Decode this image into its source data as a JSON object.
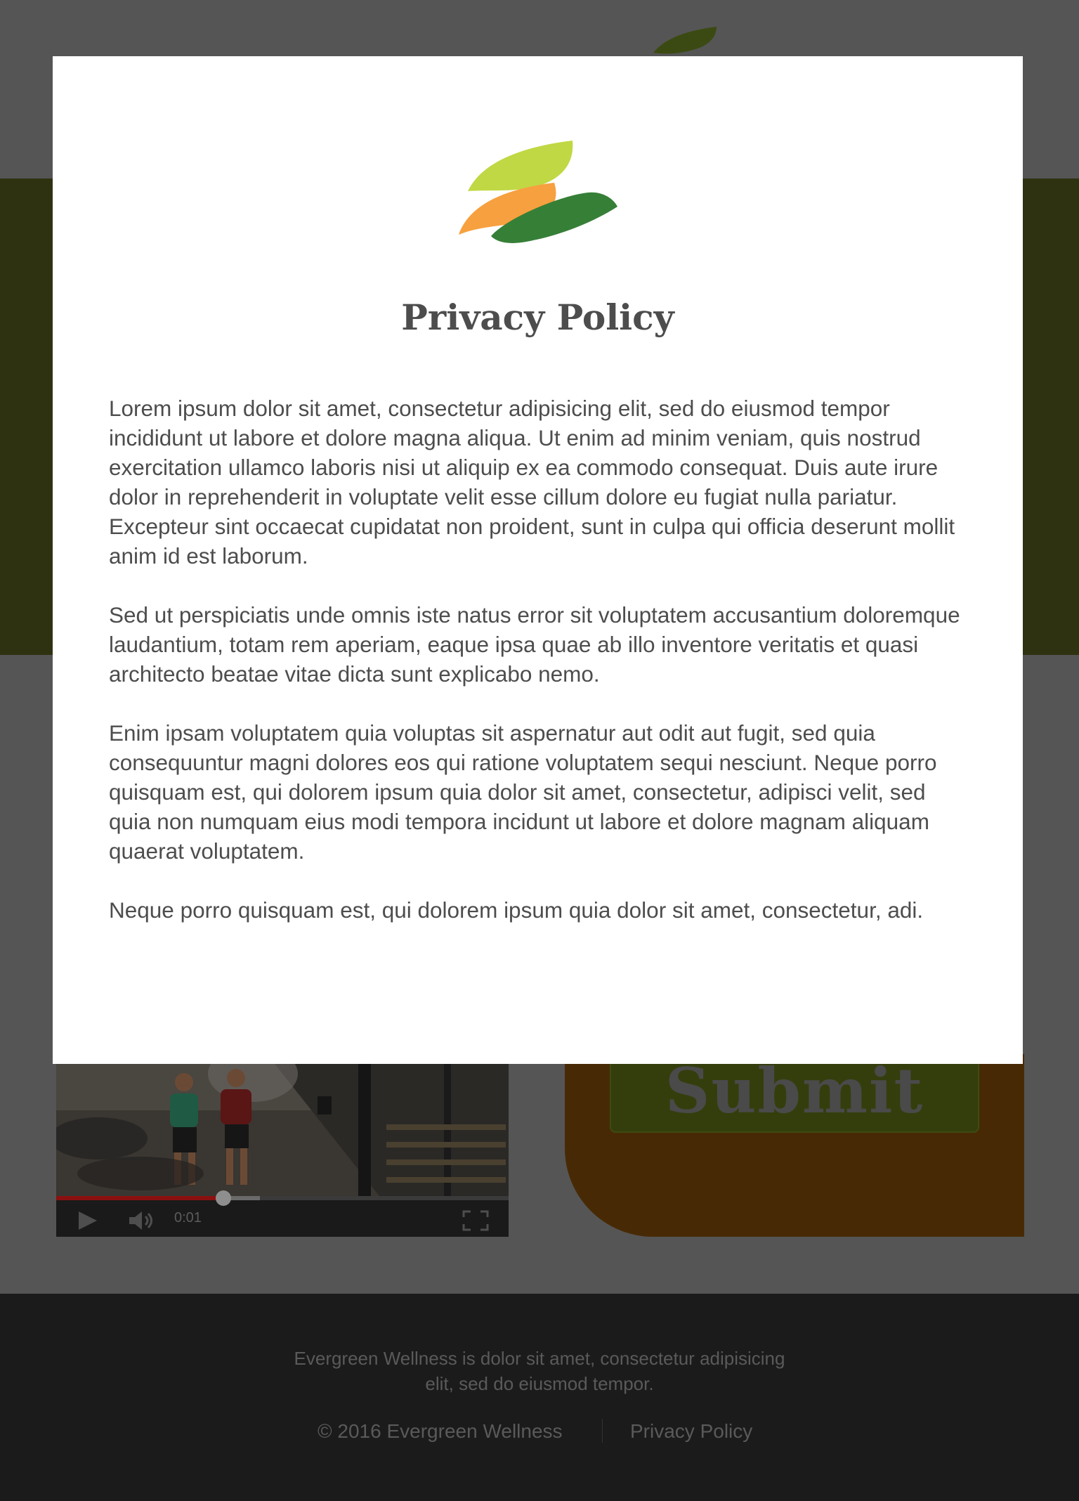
{
  "background": {
    "header_logo_icon": "evergreen-leaf-logo",
    "video": {
      "time": "0:01",
      "progress_fraction": 0.37,
      "buffered_fraction": 0.45,
      "icons": [
        "play-icon",
        "volume-icon",
        "fullscreen-icon"
      ]
    },
    "submit_label": "Submit",
    "colors": {
      "hero": "#2f3210",
      "submit_panel": "#472a05",
      "submit_button": "#343e0d",
      "footer": "#1b1b1b"
    }
  },
  "footer": {
    "description": "Evergreen Wellness is dolor sit amet, consectetur adipisicing elit, sed do eiusmod tempor.",
    "copyright": "© 2016 Evergreen Wellness",
    "privacy_link": "Privacy Policy"
  },
  "modal": {
    "logo_icon": "evergreen-leaf-logo",
    "logo_colors": [
      "#c0d844",
      "#f7a03f",
      "#367f37"
    ],
    "title": "Privacy Policy",
    "paragraphs": [
      "Lorem ipsum dolor sit amet, consectetur adipisicing elit, sed do eiusmod tempor incididunt ut labore et dolore magna aliqua. Ut enim ad minim veniam, quis nostrud exercitation ullamco laboris nisi ut aliquip ex ea commodo consequat. Duis aute irure dolor in reprehenderit in voluptate velit esse cillum dolore eu fugiat nulla pariatur. Excepteur sint occaecat cupidatat non proident, sunt in culpa qui officia deserunt mollit anim id est laborum.",
      "Sed ut perspiciatis unde omnis iste natus error sit voluptatem accusantium doloremque laudantium, totam rem aperiam, eaque ipsa quae ab illo inventore veritatis et quasi architecto beatae vitae dicta sunt explicabo nemo.",
      "Enim ipsam voluptatem quia voluptas sit aspernatur aut odit aut fugit, sed quia consequuntur magni dolores eos qui ratione voluptatem sequi nesciunt. Neque porro quisquam est, qui dolorem ipsum quia dolor sit amet, consectetur, adipisci velit, sed quia non numquam eius modi tempora incidunt ut labore et dolore magnam aliquam quaerat voluptatem.",
      "Neque porro quisquam est, qui dolorem ipsum quia dolor sit amet, consectetur, adi."
    ]
  }
}
